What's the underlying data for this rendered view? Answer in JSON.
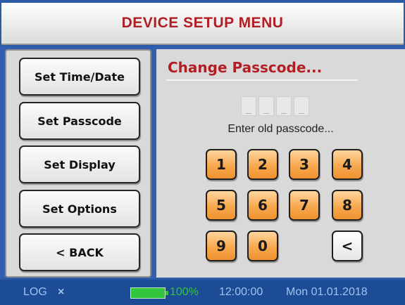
{
  "header": {
    "title": "DEVICE SETUP MENU"
  },
  "menu": {
    "items": [
      {
        "label": "Set Time/Date"
      },
      {
        "label": "Set Passcode"
      },
      {
        "label": "Set Display"
      },
      {
        "label": "Set Options"
      },
      {
        "label": "< BACK"
      }
    ]
  },
  "main": {
    "title": "Change Passcode...",
    "passcode_slots": [
      "_",
      "_",
      "_",
      "_"
    ],
    "prompt": "Enter old passcode...",
    "keys": [
      "1",
      "2",
      "3",
      "4",
      "5",
      "6",
      "7",
      "8",
      "9",
      "0"
    ],
    "back_key": "<"
  },
  "status": {
    "log_label": "LOG",
    "log_close": "×",
    "battery_percent": "100%",
    "time": "12:00:00",
    "date": "Mon 01.01.2018"
  },
  "colors": {
    "accent_red": "#b01f24",
    "key_orange": "#f7a84e",
    "status_blue": "#1d4c97",
    "battery_green": "#35c43d"
  }
}
